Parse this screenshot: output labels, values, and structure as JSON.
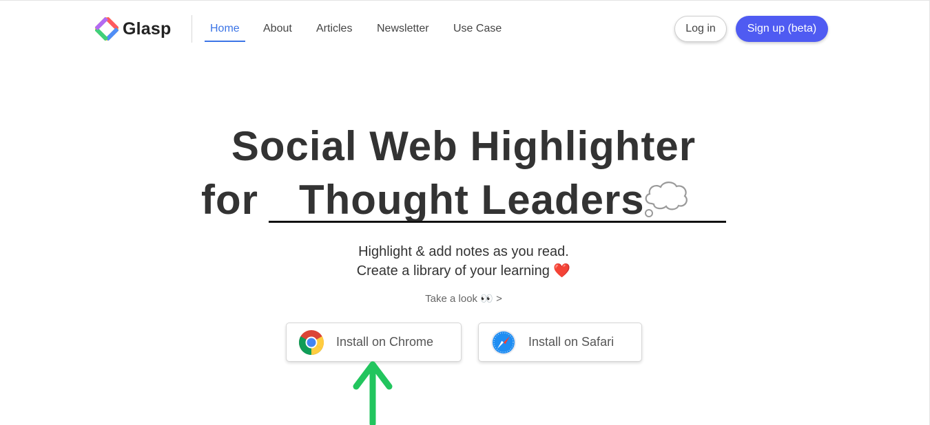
{
  "header": {
    "logo_text": "Glasp",
    "nav": [
      {
        "label": "Home",
        "active": true
      },
      {
        "label": "About",
        "active": false
      },
      {
        "label": "Articles",
        "active": false
      },
      {
        "label": "Newsletter",
        "active": false
      },
      {
        "label": "Use Case",
        "active": false
      }
    ],
    "login_label": "Log in",
    "signup_label": "Sign up (beta)"
  },
  "hero": {
    "title_line1": "Social Web Highlighter",
    "title_for": "for",
    "title_rotating": "Thought Leaders",
    "rotating_icon": "thought-balloon-icon",
    "subtitle_line1": "Highlight & add notes as you read.",
    "subtitle_line2": "Create a library of your learning",
    "subtitle_emoji": "❤️",
    "take_look": "Take a look 👀 >"
  },
  "install": {
    "chrome_label": "Install on Chrome",
    "safari_label": "Install on Safari"
  },
  "annotation": {
    "arrow_icon": "green-up-arrow-icon"
  },
  "colors": {
    "accent": "#3b74e6",
    "signup_bg": "#4f5bf2",
    "arrow": "#22c55e",
    "heart": "#e0283b"
  }
}
